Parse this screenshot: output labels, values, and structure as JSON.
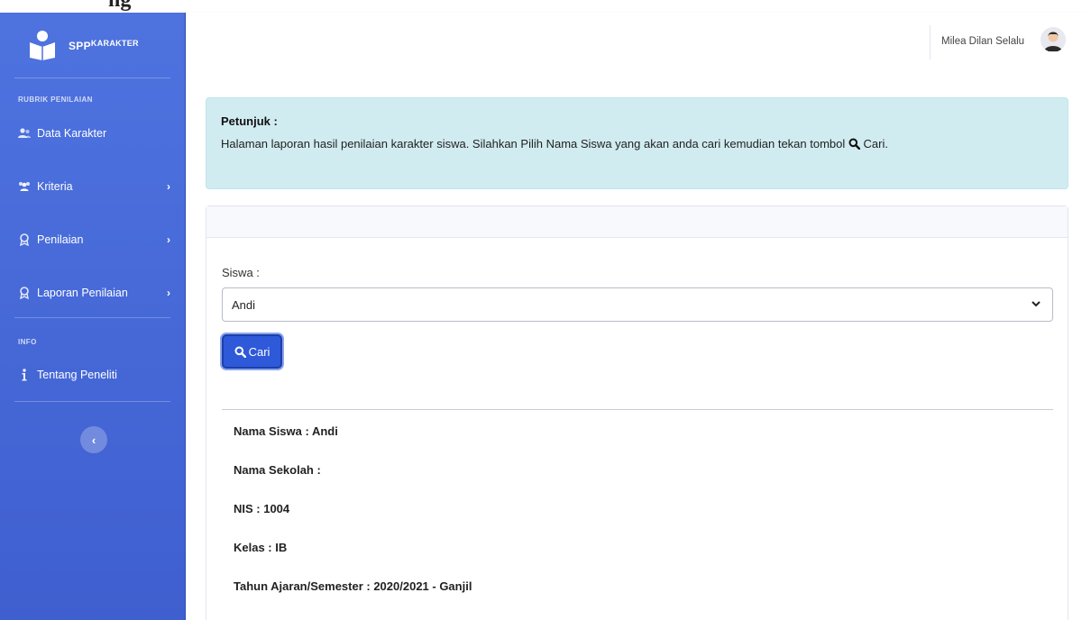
{
  "page_top": {
    "cut_text": "ng"
  },
  "brand": {
    "main": "SPP",
    "sup": "KARAKTER"
  },
  "sidebar": {
    "section_rubrik": "RUBRIK PENILAIAN",
    "section_info": "INFO",
    "items": [
      {
        "label": "Data Karakter",
        "icon": "users-icon"
      },
      {
        "label": "Kriteria",
        "icon": "users-cog-icon",
        "chevron": "›"
      },
      {
        "label": "Penilaian",
        "icon": "award-icon",
        "chevron": "›"
      },
      {
        "label": "Laporan Penilaian",
        "icon": "award-icon",
        "chevron": "›"
      },
      {
        "label": "Tentang Peneliti",
        "icon": "info-icon"
      }
    ],
    "collapse_glyph": "‹"
  },
  "topbar": {
    "user_name": "Milea Dilan Selalu"
  },
  "alert": {
    "title": "Petunjuk :",
    "text_before": "Halaman laporan hasil penilaian karakter siswa. Silahkan Pilih Nama Siswa yang akan anda cari kemudian tekan tombol",
    "text_after": "Cari."
  },
  "form": {
    "siswa_label": "Siswa :",
    "siswa_selected": "Andi",
    "cari_label": "Cari"
  },
  "student_info": {
    "nama_siswa": "Nama Siswa : Andi",
    "nama_sekolah": "Nama Sekolah :",
    "nis": "NIS : 1004",
    "kelas": "Kelas : IB",
    "tahun_ajaran": "Tahun Ajaran/Semester : 2020/2021 - Ganjil"
  },
  "colors": {
    "sidebar": "#4e73df",
    "alert_bg": "#d1ecf1",
    "button": "#2e59d9"
  }
}
